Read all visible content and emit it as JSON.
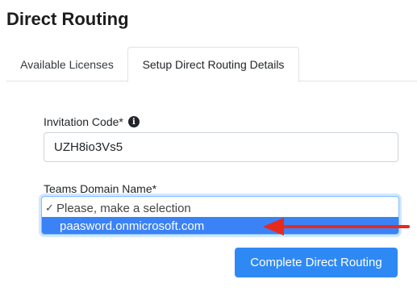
{
  "page": {
    "title": "Direct Routing"
  },
  "tabs": [
    {
      "label": "Available Licenses"
    },
    {
      "label": "Setup Direct Routing Details"
    }
  ],
  "form": {
    "invitation_code": {
      "label": "Invitation Code*",
      "value": "UZH8io3Vs5"
    },
    "teams_domain": {
      "label": "Teams Domain Name*",
      "options": [
        {
          "label": "Please, make a selection",
          "checked": true
        },
        {
          "label": "paasword.onmicrosoft.com",
          "highlighted": true
        }
      ]
    },
    "submit_label": "Complete Direct Routing"
  },
  "colors": {
    "primary": "#2f89f5",
    "highlight": "#3b82f6",
    "annotation_arrow": "#e8291c"
  }
}
